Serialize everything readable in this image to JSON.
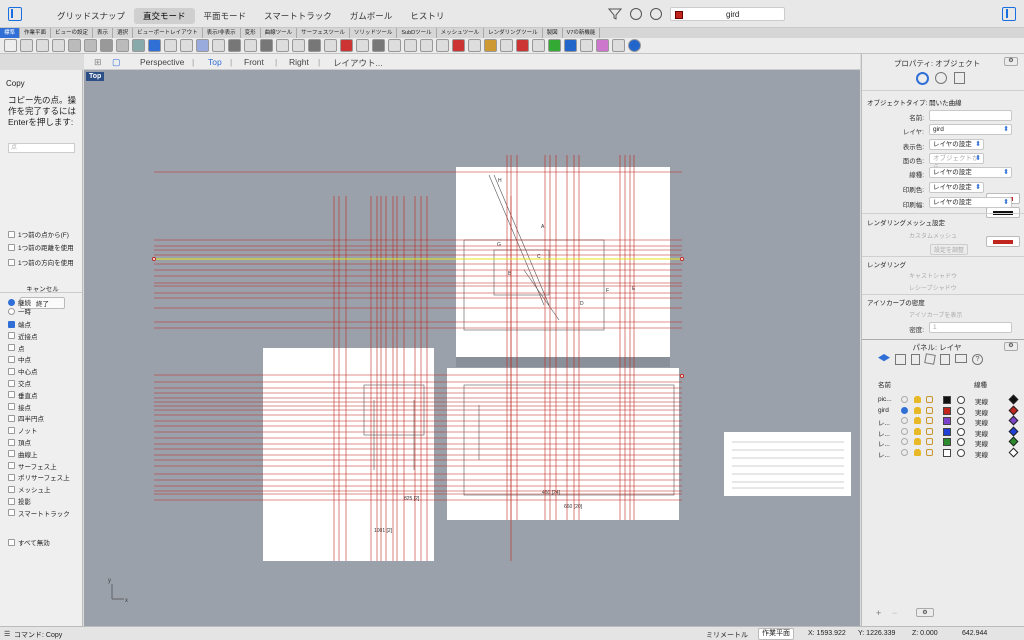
{
  "topbar": {
    "modes": [
      "グリッドスナップ",
      "直交モード",
      "平面モード",
      "スマートトラック",
      "ガムボール",
      "ヒストリ"
    ],
    "active_mode": "直交モード",
    "current_layer": "gird",
    "layer_color": "#c0261e"
  },
  "tabs": [
    "標準",
    "作業平面",
    "ビューの設定",
    "表示",
    "選択",
    "ビューポートレイアウト",
    "表示/非表示",
    "変形",
    "曲線ツール",
    "サーフェスツール",
    "ソリッドツール",
    "SubDツール",
    "メッシュツール",
    "レンダリングツール",
    "製図",
    "V7の新機能"
  ],
  "viewport_tabs": [
    "Perspective",
    "Top",
    "Front",
    "Right",
    "レイアウト..."
  ],
  "active_viewport_tab": "Top",
  "viewport_label": "Top",
  "command": {
    "name": "Copy",
    "prompt": "コピー先の点。操作を完了するにはEnterを押します:",
    "input_placeholder": "点",
    "options": [
      "1つ前の点から(F)",
      "1つ前の距離を使用",
      "1つ前の方向を使用"
    ],
    "cancel": "キャンセル",
    "finish": "終了"
  },
  "osnap": {
    "mode_permanent": "継続",
    "mode_once": "一時",
    "items": [
      {
        "label": "端点",
        "checked": true
      },
      {
        "label": "近接点",
        "checked": false
      },
      {
        "label": "点",
        "checked": false
      },
      {
        "label": "中点",
        "checked": false
      },
      {
        "label": "中心点",
        "checked": false
      },
      {
        "label": "交点",
        "checked": false
      },
      {
        "label": "垂直点",
        "checked": false
      },
      {
        "label": "接点",
        "checked": false
      },
      {
        "label": "四半円点",
        "checked": false
      },
      {
        "label": "ノット",
        "checked": false
      },
      {
        "label": "頂点",
        "checked": false
      },
      {
        "label": "曲線上",
        "checked": false
      },
      {
        "label": "サーフェス上",
        "checked": false
      },
      {
        "label": "ポリサーフェス上",
        "checked": false
      },
      {
        "label": "メッシュ上",
        "checked": false
      },
      {
        "label": "投影",
        "checked": false
      },
      {
        "label": "スマートトラック",
        "checked": false
      }
    ],
    "disable_all": "すべて無効"
  },
  "properties": {
    "title": "プロパティ: オブジェクト",
    "object_type_label": "オブジェクトタイプ:",
    "object_type": "開いた曲線",
    "name_label": "名前:",
    "name_value": "",
    "layer_label": "レイヤ:",
    "layer_value": "gird",
    "display_color_label": "表示色:",
    "display_color_value": "レイヤの設定",
    "display_color": "#c0261e",
    "face_color_label": "面の色:",
    "face_color_value": "オブジェクトから",
    "linetype_label": "線種:",
    "linetype_value": "レイヤの設定",
    "print_color_label": "印刷色:",
    "print_color_value": "レイヤの設定",
    "print_width_label": "印刷幅:",
    "print_width_value": "レイヤの設定",
    "render_mesh_section": "レンダリングメッシュ設定",
    "custom_mesh": "カスタムメッシュ",
    "adjust_settings": "設定を調整",
    "rendering_section": "レンダリング",
    "casts_shadows": "キャストシャドウ",
    "receives_shadows": "レシーブシャドウ",
    "isocurve_section": "アイソカーブの密度",
    "show_isocurves": "アイソカーブを表示",
    "density_label": "密度:",
    "density_value": "1"
  },
  "layers_panel": {
    "title": "パネル: レイヤ",
    "col_name": "名前",
    "col_linetype": "線種",
    "rows": [
      {
        "name": "pic...",
        "color": "#111111",
        "linetype": "実線",
        "mat": "#111111"
      },
      {
        "name": "gird",
        "color": "#c0261e",
        "linetype": "実線",
        "mat": "#c0261e"
      },
      {
        "name": "レ...",
        "color": "#7b43c9",
        "linetype": "実線",
        "mat": "#7b43c9"
      },
      {
        "name": "レ...",
        "color": "#1f3fd6",
        "linetype": "実線",
        "mat": "#1f3fd6"
      },
      {
        "name": "レ...",
        "color": "#2b8a2b",
        "linetype": "実線",
        "mat": "#2b8a2b"
      },
      {
        "name": "レ...",
        "color": "#ffffff",
        "linetype": "実線",
        "mat": "#ffffff"
      }
    ]
  },
  "statusbar": {
    "command": "コマンド: Copy",
    "units": "ミリメートル",
    "cplane": "作業平面",
    "x": "X: 1593.922",
    "y": "Y: 1226.339",
    "z": "Z: 0.000",
    "distance": "642.944"
  }
}
